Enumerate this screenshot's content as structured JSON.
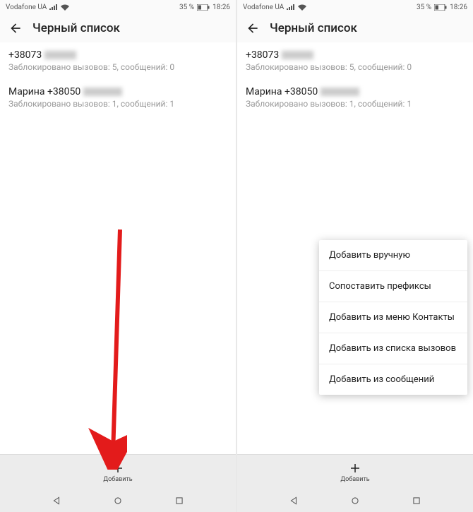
{
  "statusbar": {
    "carrier": "Vodafone UA",
    "battery": "35 %",
    "time": "18:26"
  },
  "header": {
    "title": "Черный список"
  },
  "list": [
    {
      "name_prefix": "+38073",
      "blocked": "Заблокировано вызовов: 5, сообщений: 0"
    },
    {
      "name_prefix": "Марина +38050",
      "blocked": "Заблокировано вызовов: 1, сообщений: 1"
    }
  ],
  "bottombar": {
    "add_label": "Добавить"
  },
  "menu": [
    "Добавить вручную",
    "Сопоставить префиксы",
    "Добавить из меню Контакты",
    "Добавить из списка вызовов",
    "Добавить из сообщений"
  ]
}
